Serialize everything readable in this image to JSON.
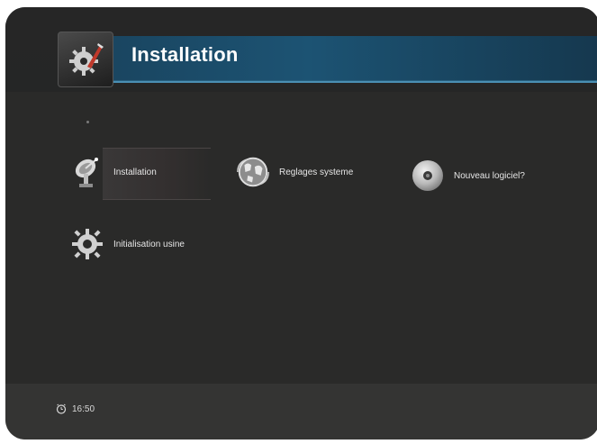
{
  "header": {
    "title": "Installation",
    "icon": "gear-wrench-icon"
  },
  "menu": {
    "items": [
      {
        "label": "Installation",
        "icon": "satellite-dish-icon",
        "selected": true
      },
      {
        "label": "Reglages systeme",
        "icon": "globe-icon",
        "selected": false
      },
      {
        "label": "Nouveau logiciel?",
        "icon": "disc-icon",
        "selected": false
      },
      {
        "label": "Initialisation usine",
        "icon": "gear-icon",
        "selected": false
      }
    ]
  },
  "footer": {
    "time": "16:50",
    "clock_icon": "alarm-clock-icon"
  },
  "colors": {
    "background": "#2a2a29",
    "header_bar": "#1c5373",
    "accent_line": "#4a8fb3",
    "text": "#e6e6e6"
  }
}
